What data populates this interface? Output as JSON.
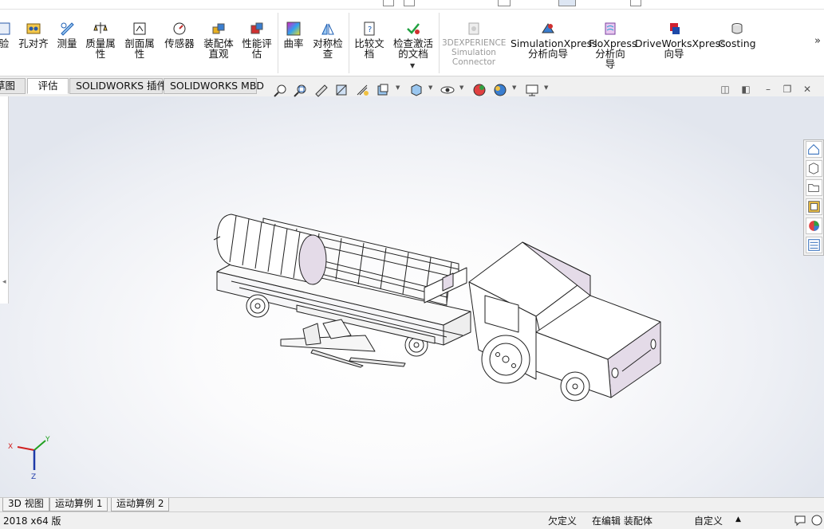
{
  "ribbon": {
    "tools": [
      {
        "label": "验",
        "icon": "check-icon"
      },
      {
        "label": "孔对齐",
        "icon": "hole-alignment-icon"
      },
      {
        "label": "测量",
        "icon": "measure-icon"
      },
      {
        "label": "质量属\n性",
        "icon": "mass-properties-icon"
      },
      {
        "label": "剖面属\n性",
        "icon": "section-properties-icon"
      },
      {
        "label": "传感器",
        "icon": "sensor-icon"
      },
      {
        "label": "装配体\n直观",
        "icon": "assemblyxpert-icon"
      },
      {
        "label": "性能评\n估",
        "icon": "performance-evaluation-icon"
      },
      {
        "label": "曲率",
        "icon": "curvature-icon"
      },
      {
        "label": "对称检\n查",
        "icon": "symmetry-check-icon"
      },
      {
        "label": "比较文\n档",
        "icon": "compare-documents-icon"
      },
      {
        "label": "检查激活\n的文档",
        "icon": "check-active-document-icon"
      },
      {
        "label": "3DEXPERIENCE\nSimulation\nConnector",
        "icon": "3dexperience-icon"
      },
      {
        "label": "SimulationXpress\n分析向导",
        "icon": "simulationxpress-icon"
      },
      {
        "label": "FloXpress\n分析向\n导",
        "icon": "floxpress-icon"
      },
      {
        "label": "DriveWorksXpress\n向导",
        "icon": "driveworksxpress-icon"
      },
      {
        "label": "Costing",
        "icon": "costing-icon"
      }
    ],
    "more": "»"
  },
  "tabs": [
    {
      "label": "草图"
    },
    {
      "label": "评估"
    },
    {
      "label": "SOLIDWORKS 插件"
    },
    {
      "label": "SOLIDWORKS MBD"
    }
  ],
  "bottom_tabs": [
    {
      "label": "3D 视图"
    },
    {
      "label": "运动算例 1"
    },
    {
      "label": "运动算例 2"
    }
  ],
  "status": {
    "version": "2018 x64 版",
    "definition": "欠定义",
    "editing": "在编辑 装配体",
    "units": "自定义",
    "units_arrow": "▲"
  },
  "triad": {
    "x": "X",
    "y": "Y",
    "z": "Z"
  },
  "colors": {
    "accent": "#1e5fb4",
    "model_fill": "#ffffff",
    "model_shade": "#e4dbe8"
  }
}
